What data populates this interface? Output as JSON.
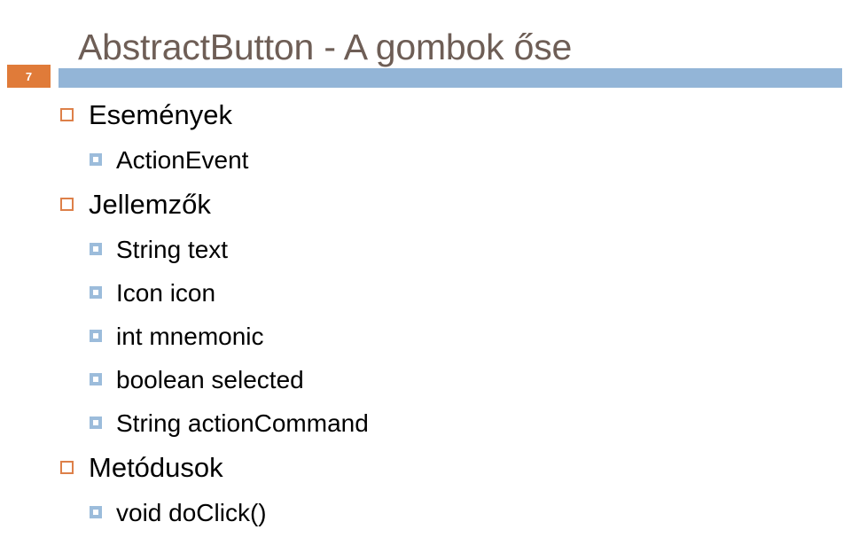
{
  "slide": {
    "title": "AbstractButton - A gombok őse",
    "number": "7",
    "colors": {
      "title_text": "#6e5e56",
      "badge_background": "#e07b39",
      "band_background": "#93b5d7",
      "level1_marker": "#dd8049",
      "level2_marker": "#9cbcdb",
      "body_text": "#000000",
      "page_background": "#ffffff"
    },
    "bullets": [
      {
        "level": 1,
        "text": "Események",
        "marker": "hollow-orange-square-bullet"
      },
      {
        "level": 2,
        "text": "ActionEvent",
        "marker": "blue-square-bullet"
      },
      {
        "level": 1,
        "text": "Jellemzők",
        "marker": "hollow-orange-square-bullet"
      },
      {
        "level": 2,
        "text": "String text",
        "marker": "blue-square-bullet"
      },
      {
        "level": 2,
        "text": "Icon icon",
        "marker": "blue-square-bullet"
      },
      {
        "level": 2,
        "text": "int mnemonic",
        "marker": "blue-square-bullet"
      },
      {
        "level": 2,
        "text": "boolean selected",
        "marker": "blue-square-bullet"
      },
      {
        "level": 2,
        "text": "String actionCommand",
        "marker": "blue-square-bullet"
      },
      {
        "level": 1,
        "text": "Metódusok",
        "marker": "hollow-orange-square-bullet"
      },
      {
        "level": 2,
        "text": "void doClick()",
        "marker": "blue-square-bullet"
      }
    ]
  }
}
